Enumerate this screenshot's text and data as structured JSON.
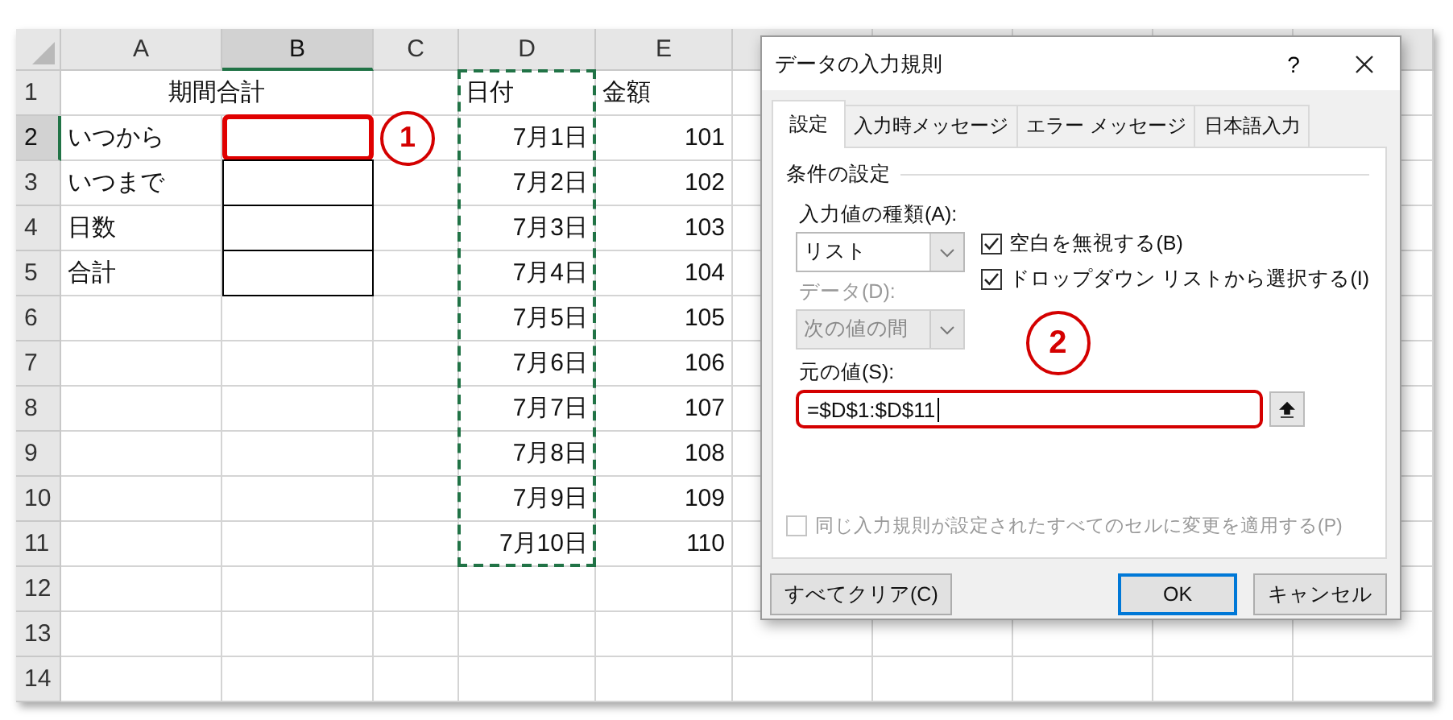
{
  "sheet": {
    "columns": [
      {
        "label": "A",
        "selected": false,
        "copied": false
      },
      {
        "label": "B",
        "selected": true,
        "copied": false
      },
      {
        "label": "C",
        "selected": false,
        "copied": false
      },
      {
        "label": "D",
        "selected": false,
        "copied": true
      },
      {
        "label": "E",
        "selected": false,
        "copied": false
      }
    ],
    "rows": [
      {
        "number": "1",
        "selected": false,
        "a": {
          "text": "期間合計",
          "kind": "merged"
        },
        "d": {
          "text": "日付",
          "kind": "text"
        },
        "e": {
          "text": "金額",
          "kind": "text"
        }
      },
      {
        "number": "2",
        "selected": true,
        "a": {
          "text": "いつから",
          "kind": "text"
        },
        "b": {
          "kind": "bordered",
          "highlighted": true
        },
        "c": {
          "text": "1",
          "kind": "callout"
        },
        "d": {
          "text": "7月1日",
          "kind": "value"
        },
        "e": {
          "text": "101",
          "kind": "value"
        }
      },
      {
        "number": "3",
        "selected": false,
        "a": {
          "text": "いつまで",
          "kind": "text"
        },
        "b": {
          "kind": "bordered",
          "highlighted": false
        },
        "d": {
          "text": "7月2日",
          "kind": "value"
        },
        "e": {
          "text": "102",
          "kind": "value"
        }
      },
      {
        "number": "4",
        "selected": false,
        "a": {
          "text": "日数",
          "kind": "text"
        },
        "b": {
          "kind": "bordered",
          "highlighted": false
        },
        "d": {
          "text": "7月3日",
          "kind": "value"
        },
        "e": {
          "text": "103",
          "kind": "value"
        }
      },
      {
        "number": "5",
        "selected": false,
        "a": {
          "text": "合計",
          "kind": "text"
        },
        "b": {
          "kind": "bordered",
          "highlighted": false
        },
        "d": {
          "text": "7月4日",
          "kind": "value"
        },
        "e": {
          "text": "104",
          "kind": "value"
        }
      },
      {
        "number": "6",
        "selected": false,
        "d": {
          "text": "7月5日",
          "kind": "value"
        },
        "e": {
          "text": "105",
          "kind": "value"
        }
      },
      {
        "number": "7",
        "selected": false,
        "d": {
          "text": "7月6日",
          "kind": "value"
        },
        "e": {
          "text": "106",
          "kind": "value"
        }
      },
      {
        "number": "8",
        "selected": false,
        "d": {
          "text": "7月7日",
          "kind": "value"
        },
        "e": {
          "text": "107",
          "kind": "value"
        }
      },
      {
        "number": "9",
        "selected": false,
        "d": {
          "text": "7月8日",
          "kind": "value"
        },
        "e": {
          "text": "108",
          "kind": "value"
        }
      },
      {
        "number": "10",
        "selected": false,
        "d": {
          "text": "7月9日",
          "kind": "value"
        },
        "e": {
          "text": "109",
          "kind": "value"
        }
      },
      {
        "number": "11",
        "selected": false,
        "d": {
          "text": "7月10日",
          "kind": "value"
        },
        "e": {
          "text": "110",
          "kind": "value"
        }
      },
      {
        "number": "12",
        "selected": false
      },
      {
        "number": "13",
        "selected": false
      },
      {
        "number": "14",
        "selected": false
      }
    ]
  },
  "dialog": {
    "title": "データの入力規則",
    "help": "?",
    "tabs": [
      {
        "label": "設定",
        "selected": true
      },
      {
        "label": "入力時メッセージ",
        "selected": false
      },
      {
        "label": "エラー メッセージ",
        "selected": false
      },
      {
        "label": "日本語入力",
        "selected": false
      }
    ],
    "section": "条件の設定",
    "allow": {
      "label": "入力値の種類(A):",
      "value": "リスト",
      "disabled": false
    },
    "data": {
      "label": "データ(D):",
      "value": "次の値の間",
      "disabled": true
    },
    "checkboxes": [
      {
        "label": "空白を無視する(B)",
        "checked": true,
        "disabled": false
      },
      {
        "label": "ドロップダウン リストから選択する(I)",
        "checked": true,
        "disabled": false
      }
    ],
    "callout": "2",
    "source": {
      "label": "元の値(S):",
      "value": "=$D$1:$D$11",
      "highlighted": true
    },
    "apply_all": {
      "label": "同じ入力規則が設定されたすべてのセルに変更を適用する(P)",
      "checked": false,
      "disabled": true
    },
    "buttons": [
      {
        "label": "すべてクリア(C)",
        "default": false
      },
      {
        "label": "OK",
        "default": true
      },
      {
        "label": "キャンセル",
        "default": false
      }
    ]
  }
}
